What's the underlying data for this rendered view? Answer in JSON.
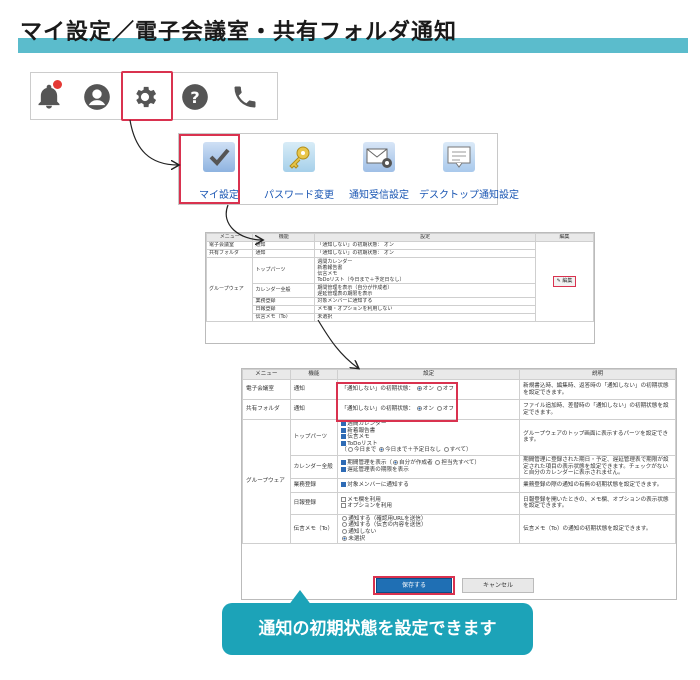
{
  "title": "マイ設定／電子会議室・共有フォルダ通知",
  "toolbar": {
    "icons": [
      "bell-icon",
      "user-icon",
      "gear-icon",
      "help-icon",
      "phone-icon"
    ]
  },
  "menu": {
    "items": [
      {
        "label": "マイ設定",
        "icon": "check-icon"
      },
      {
        "label": "パスワード変更",
        "icon": "key-icon"
      },
      {
        "label": "通知受信設定",
        "icon": "mail-gear-icon"
      },
      {
        "label": "デスクトップ通知設定",
        "icon": "desktop-notify-icon"
      }
    ]
  },
  "small_table": {
    "headers": [
      "メニュー",
      "機能",
      "設定",
      "編集"
    ],
    "rows": [
      {
        "menu": "電子会議室",
        "func": "通知",
        "setting": "「通知しない」の初期状態： オン"
      },
      {
        "menu": "共有フォルダ",
        "func": "通知",
        "setting": "「通知しない」の初期状態： オン"
      },
      {
        "menu": "",
        "func": "トップパーツ",
        "setting": "週間カレンダー\n新着報告書\n伝言メモ\nToDoリスト（今日まで＋予定日なし）"
      },
      {
        "menu": "グループウェア",
        "func": "カレンダー全般",
        "setting": "期間管理を表示（自分が作成者）\n遅延管理表の期限を表示"
      },
      {
        "menu": "",
        "func": "業務登録",
        "setting": "対象メンバーに通知する"
      },
      {
        "menu": "",
        "func": "日報登録",
        "setting": "メモ欄・オプションを利用しない"
      },
      {
        "menu": "",
        "func": "伝言メモ（To）",
        "setting": "未選択"
      }
    ],
    "edit_label": "✎ 編集"
  },
  "large_table": {
    "headers": [
      "メニュー",
      "機能",
      "設定",
      "説明"
    ],
    "row1": {
      "menu": "電子会議室",
      "func": "通知",
      "setting_label": "「通知しない」の初期状態：",
      "on": "オン",
      "off": "オフ",
      "desc": "新規書込時、編集時、返答時の「通知しない」の初期状態を設定できます。"
    },
    "row2": {
      "menu": "共有フォルダ",
      "func": "通知",
      "setting_label": "「通知しない」の初期状態：",
      "on": "オン",
      "off": "オフ",
      "desc": "ファイル追加時、差替時の「通知しない」の初期状態を設定できます。"
    },
    "group_label": "グループウェア",
    "top_parts": {
      "func": "トップパーツ",
      "checks": [
        "週間カレンダー",
        "新着報告書",
        "伝言メモ",
        "ToDoリスト"
      ],
      "todo_opts": [
        "今日まで",
        "今日まで＋予定日なし",
        "すべて"
      ],
      "desc": "グループウェアのトップ画面に表示するパーツを設定できます。"
    },
    "calendar": {
      "func": "カレンダー全般",
      "line1": "期間管理を表示",
      "opt_a": "自分が作成者",
      "opt_b": "担当先すべて",
      "line2": "遅延管理表の期限を表示",
      "desc": "期間管理に登録された期日・予定、遅延管理表で期限が設定された項目の表示状態を設定できます。チェックがないと自分のカレンダーに表示されません。"
    },
    "work": {
      "func": "業務登録",
      "check": "対象メンバーに通知する",
      "desc": "業務登録の際の通知の有無の初期状態を設定できます。"
    },
    "daily": {
      "func": "日報登録",
      "checks": [
        "メモ欄を利用",
        "オプションを利用"
      ],
      "desc": "日報登録を開いたときの、メモ欄、オプションの表示状態を設定できます。"
    },
    "memo": {
      "func": "伝言メモ（To）",
      "radios": [
        "通知する（確認用URLを送信）",
        "通知する（伝言の内容を送信）",
        "通知しない",
        "未選択"
      ],
      "desc": "伝言メモ（To）の通知の初期状態を設定できます。"
    },
    "save_label": "保存する",
    "cancel_label": "キャンセル"
  },
  "callout": "通知の初期状態を設定できます",
  "colors": {
    "accent": "#5bbccc",
    "highlight": "#d9324f",
    "callout": "#1ca3b8",
    "save": "#1f6fb4"
  }
}
